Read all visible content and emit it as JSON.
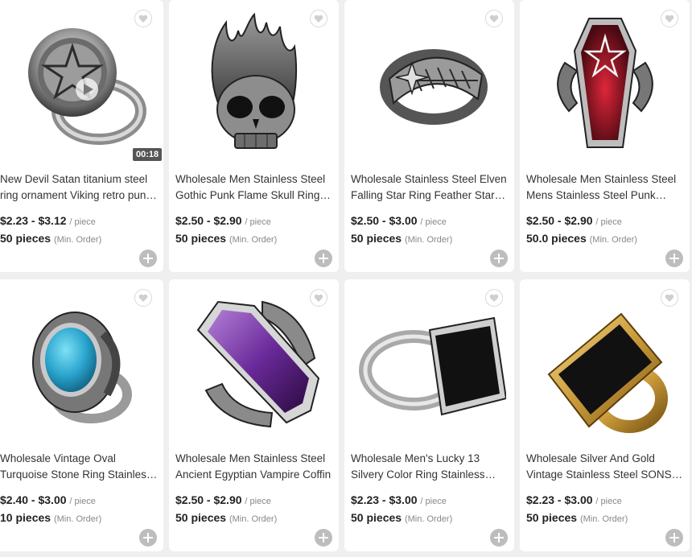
{
  "products": [
    {
      "title": "New Devil Satan titanium steel ring ornament Viking retro punk titanium",
      "price": "$2.23 - $3.12",
      "price_unit": "/ piece",
      "moq": "50 pieces",
      "moq_unit": "(Min. Order)",
      "video_duration": "00:18",
      "image": "pentagram-signet-ring"
    },
    {
      "title": "Wholesale Men Stainless Steel Gothic Punk Flame Skull Ring for biker",
      "price": "$2.50 - $2.90",
      "price_unit": "/ piece",
      "moq": "50 pieces",
      "moq_unit": "(Min. Order)",
      "image": "flame-skull-ring"
    },
    {
      "title": "Wholesale Stainless Steel Elven Falling Star Ring Feather Star vintage",
      "price": "$2.50 - $3.00",
      "price_unit": "/ piece",
      "moq": "50 pieces",
      "moq_unit": "(Min. Order)",
      "image": "feather-star-ring"
    },
    {
      "title": "Wholesale Men Stainless Steel Mens Stainless Steel Punk Coffin",
      "price": "$2.50 - $2.90",
      "price_unit": "/ piece",
      "moq": "50.0 pieces",
      "moq_unit": "(Min. Order)",
      "image": "red-coffin-ring"
    },
    {
      "title": "Wholesale Vintage Oval Turquoise Stone Ring Stainless Steel",
      "price": "$2.40 - $3.00",
      "price_unit": "/ piece",
      "moq": "10 pieces",
      "moq_unit": "(Min. Order)",
      "image": "turquoise-oval-ring"
    },
    {
      "title": "Wholesale Men Stainless Steel Ancient Egyptian Vampire Coffin",
      "price": "$2.50 - $2.90",
      "price_unit": "/ piece",
      "moq": "50 pieces",
      "moq_unit": "(Min. Order)",
      "image": "purple-coffin-ring"
    },
    {
      "title": "Wholesale Men's Lucky 13 Silvery Color Ring Stainless Steel",
      "price": "$2.23 - $3.00",
      "price_unit": "/ piece",
      "moq": "50 pieces",
      "moq_unit": "(Min. Order)",
      "image": "lucky-13-ring"
    },
    {
      "title": "Wholesale Silver And Gold Vintage Stainless Steel SONS OF ring",
      "price": "$2.23 - $3.00",
      "price_unit": "/ piece",
      "moq": "50 pieces",
      "moq_unit": "(Min. Order)",
      "image": "so-gold-ring"
    }
  ]
}
